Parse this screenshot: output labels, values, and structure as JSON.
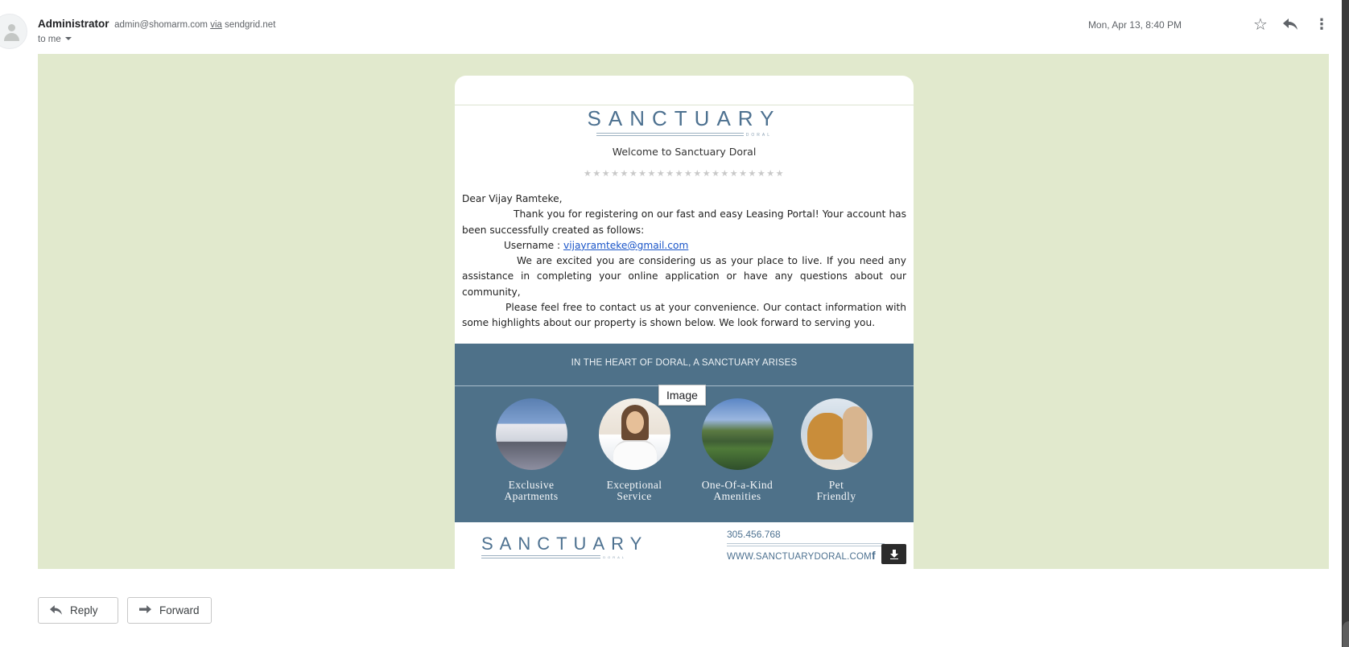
{
  "header": {
    "sender_name": "Administrator",
    "sender_email": "admin@shomarm.com",
    "via_label": "via",
    "via_domain": "sendgrid.net",
    "recipient": "to me",
    "date": "Mon, Apr 13, 8:40 PM",
    "icons": {
      "star": "star-icon",
      "reply": "reply-icon",
      "more": "more-vert-icon"
    }
  },
  "email": {
    "logo_text": "SANCTUARY",
    "logo_sub": "DORAL",
    "welcome": "Welcome to Sanctuary Doral",
    "stars": "★★★★★★★★★★★★★★★★★★★★★★",
    "greeting": "Dear Vijay Ramteke,",
    "para1": "Thank you for registering on our fast and easy Leasing Portal! Your account has been successfully created as follows:",
    "username_label": "Username :",
    "username_value": "vijayramteke@gmail.com",
    "para2": "We are excited you are considering us as your place to live. If you need any assistance in completing your online application or have any questions about our community,",
    "para3": "Please feel free to contact us at your convenience. Our contact information with some highlights about our property is shown below. We look forward to serving you.",
    "band_title": "IN THE HEART OF DORAL, A SANCTUARY ARISES",
    "features": [
      {
        "line1": "Exclusive",
        "line2": "Apartments"
      },
      {
        "line1": "Exceptional",
        "line2": "Service"
      },
      {
        "line1": "One-Of-a-Kind",
        "line2": "Amenities"
      },
      {
        "line1": "Pet",
        "line2": "Friendly"
      }
    ],
    "footer_phone": "305.456.768",
    "footer_site": "WWW.SANCTUARYDORAL.COM",
    "footer_fb": "f",
    "tooltip": "Image"
  },
  "actions": {
    "reply": "Reply",
    "forward": "Forward"
  },
  "colors": {
    "canvas_bg": "#e1e9cd",
    "brand_blue": "#4e7189",
    "link": "#1a55c8"
  }
}
